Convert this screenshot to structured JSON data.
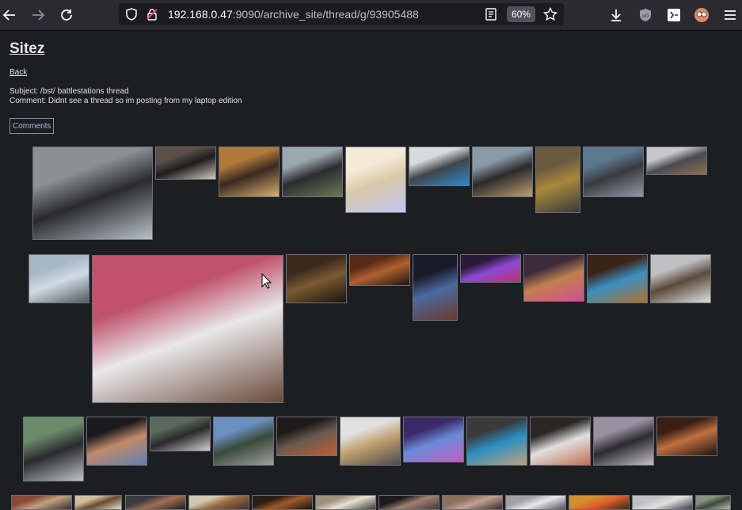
{
  "browser": {
    "url_host": "192.168.0.47",
    "url_rest": ":9090/archive_site/thread/g/93905488",
    "zoom": "60%"
  },
  "page": {
    "site_title": "Sitez",
    "back_label": "Back",
    "subject": "Subject: /bst/ battlestations thread",
    "comment": "Comment: Didnt see a thread so im posting from my laptop edition",
    "comments_button": "Comments"
  },
  "gallery": {
    "rows": [
      [
        {
          "colors": [
            "#8a9096",
            "#2a2a2e",
            "#b7c2c9"
          ]
        },
        {
          "colors": [
            "#5a5048",
            "#1e1c1c",
            "#cfcac0"
          ]
        },
        {
          "colors": [
            "#b07a3a",
            "#3a2a1e",
            "#d8b070"
          ]
        },
        {
          "colors": [
            "#9aa8b0",
            "#2c2c2e",
            "#6a7a5a"
          ]
        },
        {
          "colors": [
            "#f4ead8",
            "#d8c8a8",
            "#c0c8f0"
          ]
        },
        {
          "colors": [
            "#d8dadc",
            "#40464a",
            "#2a8ad0"
          ]
        },
        {
          "colors": [
            "#8a9aa8",
            "#2a2a2a",
            "#c0a070"
          ]
        },
        {
          "colors": [
            "#6a5a40",
            "#a8883a",
            "#3a3a3a"
          ]
        },
        {
          "colors": [
            "#5a7890",
            "#3a3a3e",
            "#909aa8"
          ]
        },
        {
          "colors": [
            "#c8c8cc",
            "#4a4a50",
            "#907050"
          ]
        }
      ],
      [
        {
          "colors": [
            "#a8b8c8",
            "#d0dce4",
            "#505a60"
          ]
        },
        {
          "colors": [
            "#c0526a",
            "#e8e8ea",
            "#6a4a3a"
          ]
        },
        {
          "colors": [
            "#3a2a1e",
            "#7a5a30",
            "#1a1410"
          ]
        },
        {
          "colors": [
            "#5a2a18",
            "#b06030",
            "#1e1410"
          ]
        },
        {
          "colors": [
            "#1a1a2a",
            "#4a6aa0",
            "#6a3a2a"
          ]
        },
        {
          "colors": [
            "#2a1a3a",
            "#8a4ad0",
            "#c03070"
          ]
        },
        {
          "colors": [
            "#3a2a3a",
            "#c08050",
            "#d05090"
          ]
        },
        {
          "colors": [
            "#3a2418",
            "#3a90c0",
            "#b07030"
          ]
        },
        {
          "colors": [
            "#c0c0c4",
            "#5a4a3a",
            "#e0e0e0"
          ]
        }
      ],
      [
        {
          "colors": [
            "#6a8a6a",
            "#2a2a2e",
            "#c0c4c8"
          ]
        },
        {
          "colors": [
            "#1a1a1e",
            "#c08a6a",
            "#6080b0"
          ]
        },
        {
          "colors": [
            "#5a6a5a",
            "#2a2a2a",
            "#d0d0d0"
          ]
        },
        {
          "colors": [
            "#6a90c0",
            "#3a4a3a",
            "#a0a0a0"
          ]
        },
        {
          "colors": [
            "#1e1a1a",
            "#6a5a50",
            "#c06030"
          ]
        },
        {
          "colors": [
            "#e0e0e0",
            "#c0a070",
            "#4a4a4a"
          ]
        },
        {
          "colors": [
            "#3a2a6a",
            "#6a8ad8",
            "#c060c0"
          ]
        },
        {
          "colors": [
            "#3a3a3a",
            "#2a90c0",
            "#c0a080"
          ]
        },
        {
          "colors": [
            "#2a2624",
            "#e0e0e0",
            "#c07050"
          ]
        },
        {
          "colors": [
            "#9a90a0",
            "#2a2a30",
            "#c8c0c8"
          ]
        },
        {
          "colors": [
            "#3a1e14",
            "#c07040",
            "#1a1410"
          ]
        }
      ],
      [
        {
          "colors": [
            "#8a4a3a",
            "#c0a080",
            "#3a2a2a"
          ]
        },
        {
          "colors": [
            "#d0c0a0",
            "#6a4a30",
            "#e0e0d0"
          ]
        },
        {
          "colors": [
            "#3a3a40",
            "#a07050",
            "#1e1e22"
          ]
        },
        {
          "colors": [
            "#d0c8b0",
            "#9a6a40",
            "#3a3030"
          ]
        },
        {
          "colors": [
            "#2a1e14",
            "#a05a2a",
            "#1a1410"
          ]
        },
        {
          "colors": [
            "#a09080",
            "#e8e0d0",
            "#3a3a3a"
          ]
        },
        {
          "colors": [
            "#1e1a1a",
            "#a08070",
            "#403a3a"
          ]
        },
        {
          "colors": [
            "#8a7060",
            "#c0a090",
            "#3a2a2a"
          ]
        },
        {
          "colors": [
            "#a0a0a4",
            "#e8e8ea",
            "#505058"
          ]
        },
        {
          "colors": [
            "#d09030",
            "#e06030",
            "#3a2a1a"
          ]
        },
        {
          "colors": [
            "#c0c0c4",
            "#e0e0e0",
            "#3a3a40"
          ]
        },
        {
          "colors": [
            "#8a9080",
            "#3a4a3a",
            "#c0c0b0"
          ]
        }
      ]
    ]
  }
}
